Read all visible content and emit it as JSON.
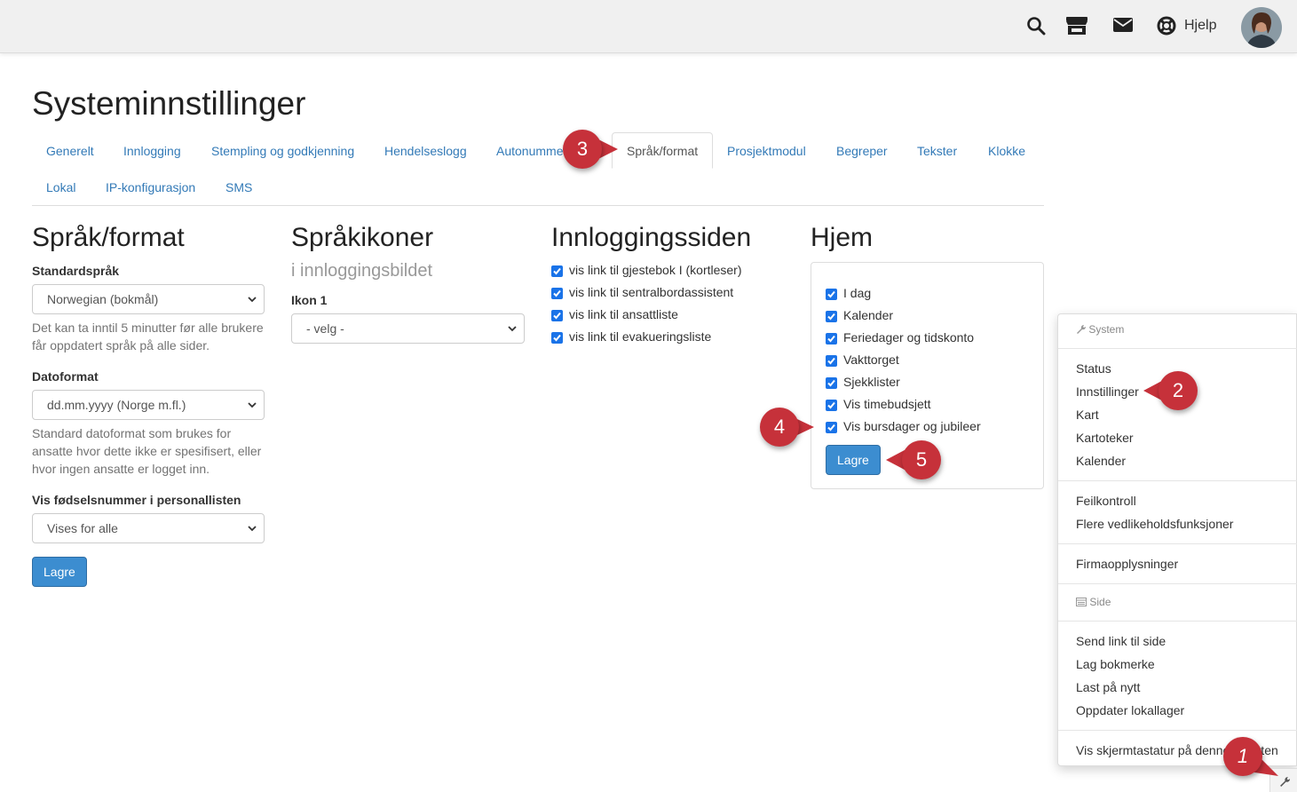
{
  "topbar": {
    "icons": [
      "search-icon",
      "store-icon",
      "mail-icon",
      "lifebuoy-icon"
    ],
    "help_label": "Hjelp"
  },
  "page_title": "Systeminnstillinger",
  "tabs": [
    {
      "label": "Generelt"
    },
    {
      "label": "Innlogging"
    },
    {
      "label": "Stempling og godkjenning"
    },
    {
      "label": "Hendelseslogg"
    },
    {
      "label": "Autonummer"
    },
    {
      "label": "Språk/format",
      "active": true
    },
    {
      "label": "Prosjektmodul"
    },
    {
      "label": "Begreper"
    },
    {
      "label": "Tekster"
    },
    {
      "label": "Klokke"
    },
    {
      "label": "Lokal"
    },
    {
      "label": "IP-konfigurasjon"
    },
    {
      "label": "SMS"
    }
  ],
  "sprak_format": {
    "title": "Språk/format",
    "language_label": "Standardspråk",
    "language_value": "Norwegian (bokmål)",
    "language_help": [
      "Det kan ta inntil 5 minutter før alle brukere",
      "får oppdatert språk på alle sider."
    ],
    "date_label": "Datoformat",
    "date_value": "dd.mm.yyyy (Norge m.fl.)",
    "date_help": [
      "Standard datoformat som brukes for",
      "ansatte hvor dette ikke er spesifisert, eller",
      "hvor ingen ansatte er logget inn."
    ],
    "birthnum_label": "Vis fødselsnummer i personallisten",
    "birthnum_value": "Vises for alle",
    "save": "Lagre"
  },
  "sprakikoner": {
    "title": "Språkikoner",
    "subtitle": "i innloggingsbildet",
    "icon_label": "Ikon 1",
    "icon_value": "- velg -"
  },
  "innlogging": {
    "title": "Innloggingssiden",
    "checkboxes": [
      "vis link til gjestebok I (kortleser)",
      "vis link til sentralbordassistent",
      "vis link til ansattliste",
      "vis link til evakueringsliste"
    ]
  },
  "hjem": {
    "title": "Hjem",
    "checkboxes": [
      "I dag",
      "Kalender",
      "Feriedager og tidskonto",
      "Vakttorget",
      "Sjekklister",
      "Vis timebudsjett",
      "Vis bursdager og jubileer"
    ],
    "save": "Lagre"
  },
  "menu": {
    "system_header": "System",
    "group1": [
      "Status",
      "Innstillinger",
      "Kart",
      "Kartoteker",
      "Kalender"
    ],
    "group2": [
      "Feilkontroll",
      "Flere vedlikeholdsfunksjoner"
    ],
    "group3": [
      "Firmaopplysninger"
    ],
    "side_header": "Side",
    "group4": [
      "Send link til side",
      "Lag bokmerke",
      "Last på nytt",
      "Oppdater lokallager"
    ],
    "group5": [
      "Vis skjermtastatur på denne enheten"
    ]
  },
  "markers": [
    "1",
    "2",
    "3",
    "4",
    "5"
  ],
  "colors": {
    "marker": "#c6313a",
    "link": "#337ab7",
    "primary": "#3c8dd0",
    "checkbox": "#1a73e8"
  }
}
